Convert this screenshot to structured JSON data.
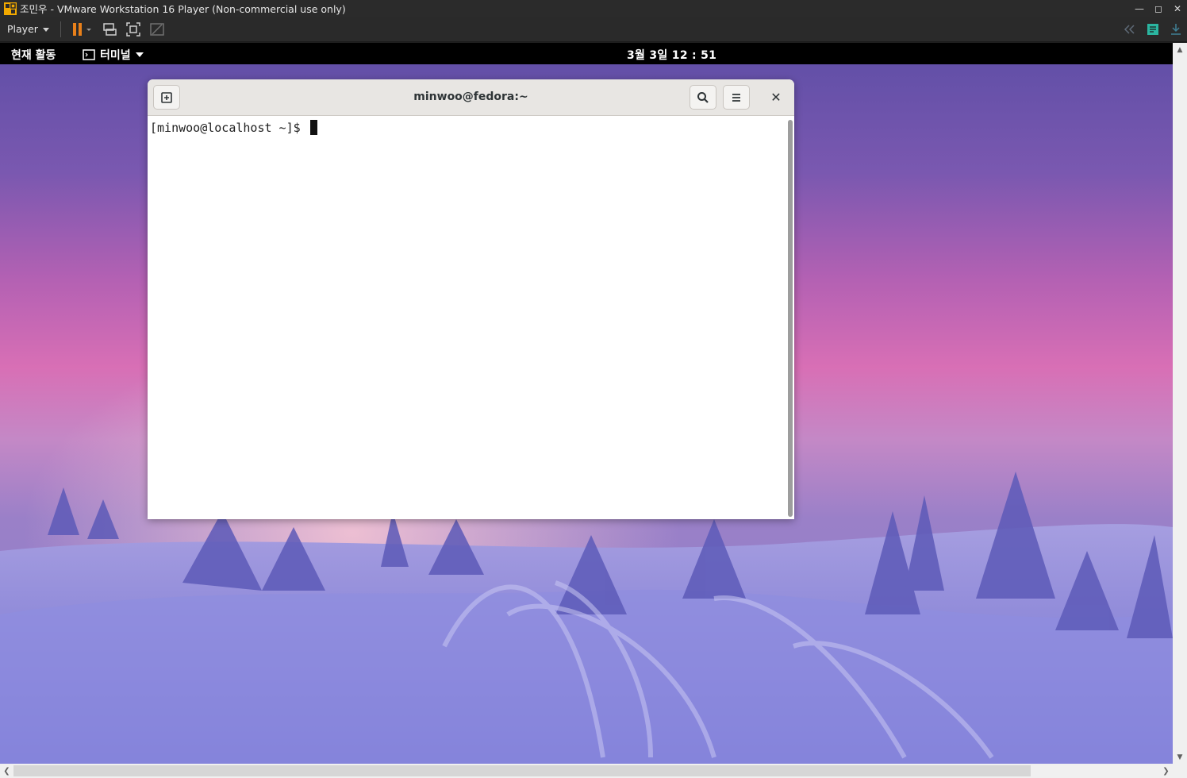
{
  "host_window": {
    "title": "조민우 - VMware Workstation 16 Player (Non-commercial use only)",
    "icon": "vmware-icon",
    "controls": [
      "minimize-icon",
      "maximize-icon",
      "close-icon"
    ]
  },
  "toolbar": {
    "player_label": "Player",
    "buttons": [
      "pause-icon",
      "send-ctrl-alt-del-icon",
      "fullscreen-icon",
      "unity-icon"
    ],
    "right_buttons": [
      "collapse-icon",
      "notes-icon",
      "download-icon"
    ]
  },
  "gnome_bar": {
    "activities": "현재 활동",
    "app_menu": "터미널",
    "clock": "3월 3일 12 : 51"
  },
  "terminal": {
    "title": "minwoo@fedora:~",
    "prompt": "[minwoo@localhost ~]$ "
  },
  "colors": {
    "sky_top": "#6b53a8",
    "sky_pink": "#c46bb3",
    "snow": "#8f8fd8",
    "gnome_bar": "#000000"
  }
}
